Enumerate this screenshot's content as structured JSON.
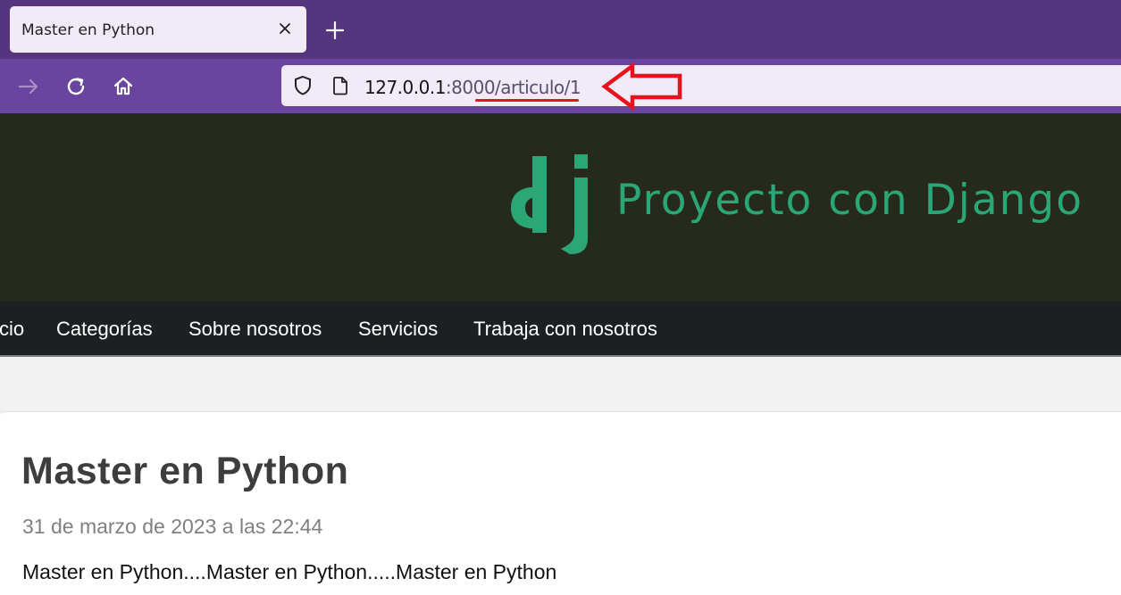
{
  "browser": {
    "tab_title": "Master en Python",
    "url_host": "127.0.0.1",
    "url_rest": ":8000/articulo/1",
    "icons": [
      "close-icon",
      "plus-icon",
      "forward-arrow-icon",
      "reload-icon",
      "home-icon",
      "shield-icon",
      "page-icon"
    ],
    "accent_color": "#55357e"
  },
  "header": {
    "logo_text": "dj",
    "title": "Proyecto con Django",
    "brand_color": "#2ba676"
  },
  "menu": {
    "items": [
      {
        "label": "cio"
      },
      {
        "label": "Categorías"
      },
      {
        "label": "Sobre nosotros"
      },
      {
        "label": "Servicios"
      },
      {
        "label": "Trabaja con nosotros"
      }
    ]
  },
  "article": {
    "title": "Master en Python",
    "date": "31 de marzo de 2023 a las 22:44",
    "body": "Master en Python....Master en Python.....Master en Python"
  },
  "annotation": {
    "arrow_color": "#e8121d"
  }
}
